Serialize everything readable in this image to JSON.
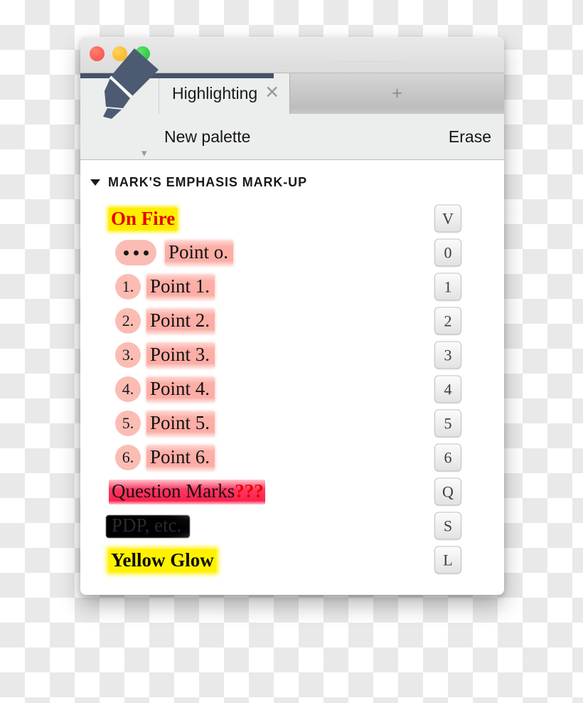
{
  "window": {
    "traffic_lights": [
      {
        "name": "close",
        "color": "#f94a41"
      },
      {
        "name": "minimize",
        "color": "#f5b11a"
      },
      {
        "name": "zoom",
        "color": "#1dbe31"
      }
    ]
  },
  "tabs": {
    "tool_icon": "highlighter-marker-icon",
    "tool_caret": "▾",
    "active": {
      "label": "Highlighting",
      "close_glyph": "✕"
    },
    "new_tab_glyph": "+"
  },
  "toolbar": {
    "new_palette_label": "New palette",
    "erase_label": "Erase"
  },
  "section": {
    "caret": "▾",
    "title": "MARK'S EMPHASIS MARK-UP"
  },
  "palette_rows": [
    {
      "style": "onfire",
      "badge": null,
      "label": "On Fire",
      "shortcut": "V",
      "colors": {
        "text": "#e50000",
        "highlight": "#ffee00"
      }
    },
    {
      "style": "pink",
      "badge": {
        "type": "dots",
        "value": "•••"
      },
      "label": "Point o.",
      "shortcut": "0",
      "colors": {
        "text": "#111111",
        "highlight": "#fca8a0"
      }
    },
    {
      "style": "pink",
      "badge": {
        "type": "number",
        "value": "1."
      },
      "label": "Point 1.",
      "shortcut": "1",
      "colors": {
        "text": "#111111",
        "highlight": "#fca8a0"
      }
    },
    {
      "style": "pink",
      "badge": {
        "type": "number",
        "value": "2."
      },
      "label": "Point 2.",
      "shortcut": "2",
      "colors": {
        "text": "#111111",
        "highlight": "#fca8a0"
      }
    },
    {
      "style": "pink",
      "badge": {
        "type": "number",
        "value": "3."
      },
      "label": "Point 3.",
      "shortcut": "3",
      "colors": {
        "text": "#111111",
        "highlight": "#fca8a0"
      }
    },
    {
      "style": "pink",
      "badge": {
        "type": "number",
        "value": "4."
      },
      "label": "Point 4.",
      "shortcut": "4",
      "colors": {
        "text": "#111111",
        "highlight": "#fca8a0"
      }
    },
    {
      "style": "pink",
      "badge": {
        "type": "number",
        "value": "5."
      },
      "label": "Point 5.",
      "shortcut": "5",
      "colors": {
        "text": "#111111",
        "highlight": "#fca8a0"
      }
    },
    {
      "style": "pink",
      "badge": {
        "type": "number",
        "value": "6."
      },
      "label": "Point 6.",
      "shortcut": "6",
      "colors": {
        "text": "#111111",
        "highlight": "#fca8a0"
      }
    },
    {
      "style": "question",
      "badge": null,
      "label": "Question Marks",
      "suffix": "???",
      "shortcut": "Q",
      "colors": {
        "text": "#111111",
        "highlight": "#fa1e4b",
        "suffix": "#ee0000"
      }
    },
    {
      "style": "redacted",
      "badge": null,
      "label": "PDP, etc.",
      "shortcut": "S",
      "colors": {
        "text": "#2a2a2a",
        "highlight": "#000000"
      }
    },
    {
      "style": "glow",
      "badge": null,
      "label": "Yellow Glow",
      "shortcut": "L",
      "colors": {
        "text": "#0d0d0d",
        "highlight": "#fff200"
      }
    }
  ]
}
